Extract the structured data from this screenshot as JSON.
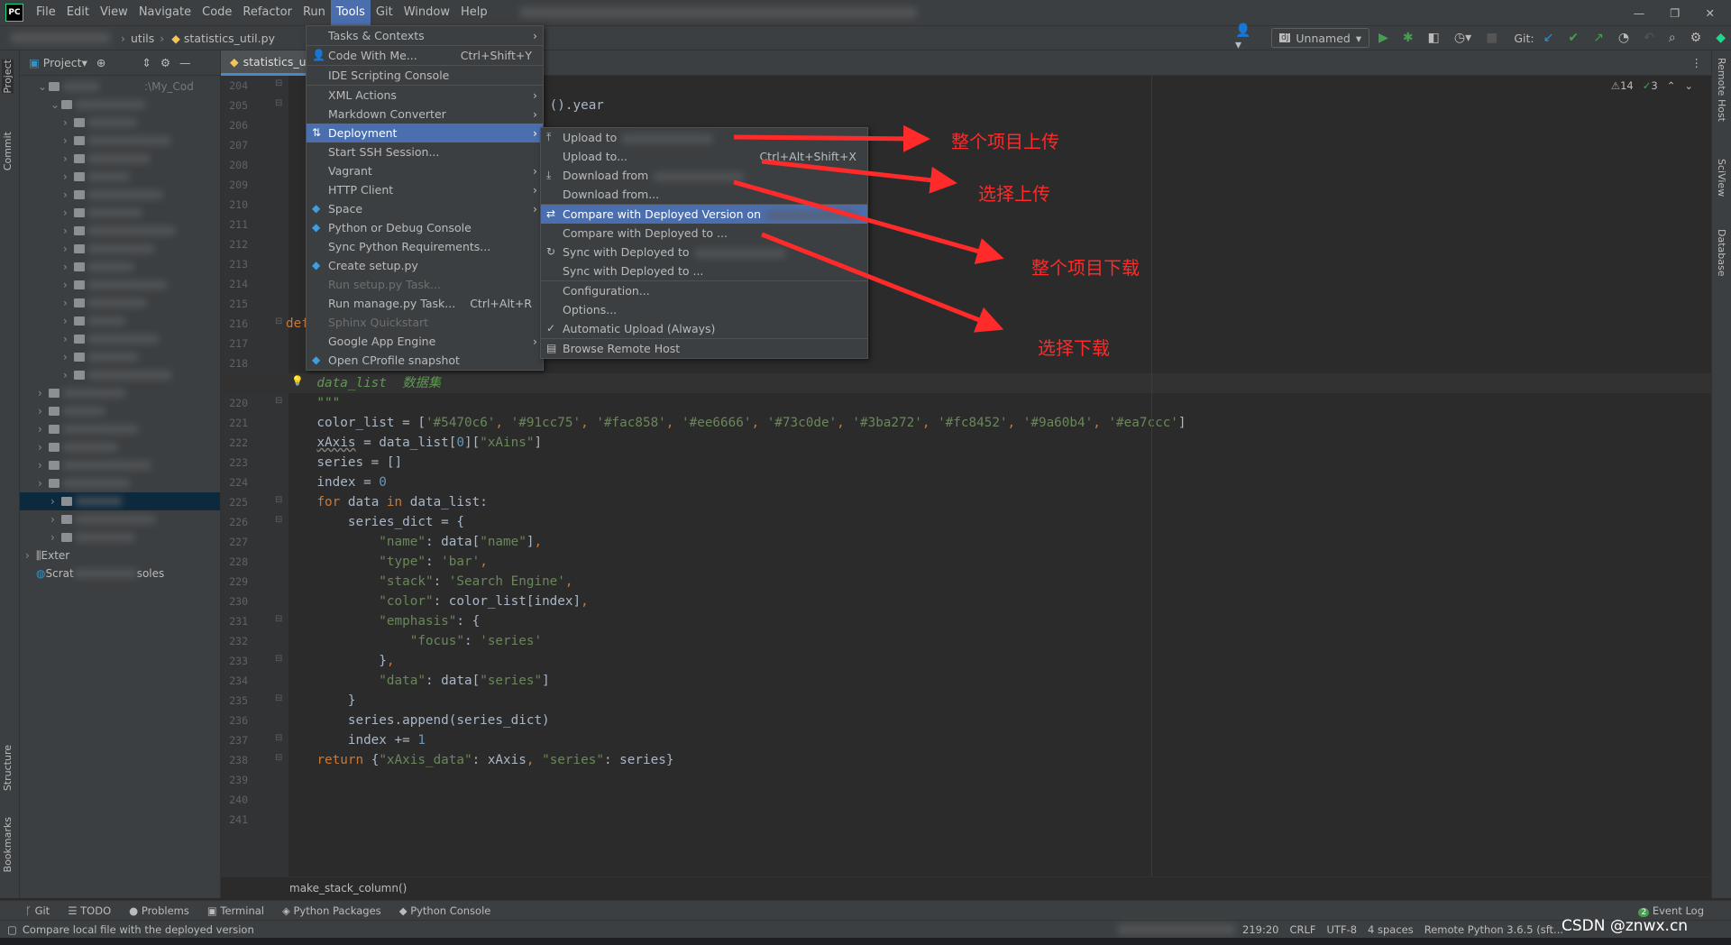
{
  "app": {
    "logo": "PC",
    "menu": [
      "File",
      "Edit",
      "View",
      "Navigate",
      "Code",
      "Refactor",
      "Run",
      "Tools",
      "Git",
      "Window",
      "Help"
    ],
    "active_menu": "Tools"
  },
  "navbar": {
    "crumb_folder": "utils",
    "crumb_file": "statistics_util.py",
    "run_config": "Unnamed",
    "git_label": "Git:"
  },
  "project": {
    "header": "Project",
    "path_fragment": ":\\My_Cod",
    "external": "Exter",
    "scratches_start": "Scrat",
    "scratches_end": "soles"
  },
  "left_stripe": [
    "Project",
    "Commit",
    "Structure",
    "Bookmarks"
  ],
  "right_stripe": [
    "Remote Host",
    "SciView",
    "Database"
  ],
  "editor": {
    "tab": "statistics_util.py",
    "warnings": "14",
    "weak_warnings": "3",
    "breadcrumb": "make_stack_column()",
    "current_line": 219,
    "first_line": 204,
    "last_line": 241,
    "lines": {
      "205": [
        [
          "                                  ().year",
          ""
        ]
      ],
      "216": [
        [
          "def",
          "kw"
        ]
      ],
      "219": [
        [
          "    data_list  数据集",
          "com"
        ]
      ],
      "220": [
        [
          "    \"\"\"",
          "com"
        ]
      ],
      "221": [
        [
          "    color_list = [",
          ""
        ],
        [
          "'#5470c6'",
          "str"
        ],
        [
          ", ",
          "kw"
        ],
        [
          "'#91cc75'",
          "str"
        ],
        [
          ", ",
          "kw"
        ],
        [
          "'#fac858'",
          "str"
        ],
        [
          ", ",
          "kw"
        ],
        [
          "'#ee6666'",
          "str"
        ],
        [
          ", ",
          "kw"
        ],
        [
          "'#73c0de'",
          "str"
        ],
        [
          ", ",
          "kw"
        ],
        [
          "'#3ba272'",
          "str"
        ],
        [
          ", ",
          "kw"
        ],
        [
          "'#fc8452'",
          "str"
        ],
        [
          ", ",
          "kw"
        ],
        [
          "'#9a60b4'",
          "str"
        ],
        [
          ", ",
          "kw"
        ],
        [
          "'#ea7ccc'",
          "str"
        ],
        [
          "]",
          ""
        ]
      ],
      "222": [
        [
          "    ",
          ""
        ],
        [
          "xAxis",
          "sq"
        ],
        [
          " = data_list[",
          ""
        ],
        [
          "0",
          "num"
        ],
        [
          "][",
          ""
        ],
        [
          "\"xAins\"",
          "str"
        ],
        [
          "]",
          ""
        ]
      ],
      "223": [
        [
          "    series = []",
          ""
        ]
      ],
      "224": [
        [
          "    index = ",
          ""
        ],
        [
          "0",
          "num"
        ]
      ],
      "225": [
        [
          "    ",
          ""
        ],
        [
          "for",
          "kw"
        ],
        [
          " data ",
          ""
        ],
        [
          "in",
          "kw"
        ],
        [
          " data_list:",
          ""
        ]
      ],
      "226": [
        [
          "        series_dict = {",
          ""
        ]
      ],
      "227": [
        [
          "            ",
          ""
        ],
        [
          "\"name\"",
          "str"
        ],
        [
          ": data[",
          ""
        ],
        [
          "\"name\"",
          "str"
        ],
        [
          "]",
          ""
        ],
        [
          ",",
          "kw"
        ]
      ],
      "228": [
        [
          "            ",
          ""
        ],
        [
          "\"type\"",
          "str"
        ],
        [
          ": ",
          ""
        ],
        [
          "'bar'",
          "str"
        ],
        [
          ",",
          "kw"
        ]
      ],
      "229": [
        [
          "            ",
          ""
        ],
        [
          "\"stack\"",
          "str"
        ],
        [
          ": ",
          ""
        ],
        [
          "'Search Engine'",
          "str"
        ],
        [
          ",",
          "kw"
        ]
      ],
      "230": [
        [
          "            ",
          ""
        ],
        [
          "\"color\"",
          "str"
        ],
        [
          ": color_list[index]",
          ""
        ],
        [
          ",",
          "kw"
        ]
      ],
      "231": [
        [
          "            ",
          ""
        ],
        [
          "\"emphasis\"",
          "str"
        ],
        [
          ": {",
          ""
        ]
      ],
      "232": [
        [
          "                ",
          ""
        ],
        [
          "\"focus\"",
          "str"
        ],
        [
          ": ",
          ""
        ],
        [
          "'series'",
          "str"
        ]
      ],
      "233": [
        [
          "            }",
          ""
        ],
        [
          ",",
          "kw"
        ]
      ],
      "234": [
        [
          "            ",
          ""
        ],
        [
          "\"data\"",
          "str"
        ],
        [
          ": data[",
          ""
        ],
        [
          "\"series\"",
          "str"
        ],
        [
          "]",
          ""
        ]
      ],
      "235": [
        [
          "        }",
          ""
        ]
      ],
      "236": [
        [
          "        series.append(series_dict)",
          ""
        ]
      ],
      "237": [
        [
          "        index += ",
          ""
        ],
        [
          "1",
          "num"
        ]
      ],
      "238": [
        [
          "    ",
          ""
        ],
        [
          "return",
          "kw"
        ],
        [
          " {",
          ""
        ],
        [
          "\"xAxis_data\"",
          "str"
        ],
        [
          ": xAxis",
          ""
        ],
        [
          ", ",
          "kw"
        ],
        [
          "\"series\"",
          "str"
        ],
        [
          ": series}",
          ""
        ]
      ]
    }
  },
  "tools_menu": [
    {
      "label": "Tasks & Contexts",
      "submenu": true
    },
    {
      "sep": true
    },
    {
      "label": "Code With Me...",
      "shortcut": "Ctrl+Shift+Y",
      "icon": "user-icon"
    },
    {
      "sep": true
    },
    {
      "label": "IDE Scripting Console"
    },
    {
      "sep": true
    },
    {
      "label": "XML Actions",
      "submenu": true
    },
    {
      "label": "Markdown Converter",
      "submenu": true
    },
    {
      "label": "Deployment",
      "submenu": true,
      "selected": true,
      "icon": "deploy-icon"
    },
    {
      "label": "Start SSH Session..."
    },
    {
      "label": "Vagrant",
      "submenu": true
    },
    {
      "label": "HTTP Client",
      "submenu": true
    },
    {
      "label": "Space",
      "submenu": true,
      "icon": "space-icon"
    },
    {
      "label": "Python or Debug Console",
      "icon": "python-icon"
    },
    {
      "label": "Sync Python Requirements..."
    },
    {
      "label": "Create setup.py",
      "icon": "python-file-icon"
    },
    {
      "label": "Run setup.py Task...",
      "disabled": true
    },
    {
      "label": "Run manage.py Task...",
      "shortcut": "Ctrl+Alt+R"
    },
    {
      "label": "Sphinx Quickstart",
      "disabled": true
    },
    {
      "label": "Google App Engine",
      "submenu": true
    },
    {
      "label": "Open CProfile snapshot",
      "icon": "python-file-icon"
    }
  ],
  "deployment_menu": [
    {
      "label": "Upload to",
      "icon": "upload-icon",
      "blurred": true
    },
    {
      "label": "Upload to...",
      "shortcut": "Ctrl+Alt+Shift+X"
    },
    {
      "label": "Download from",
      "icon": "download-icon",
      "blurred": true
    },
    {
      "label": "Download from..."
    },
    {
      "sep": true
    },
    {
      "label": "Compare with Deployed Version on",
      "icon": "compare-icon",
      "selected": true,
      "blurred": true
    },
    {
      "label": "Compare with Deployed to ..."
    },
    {
      "label": "Sync with Deployed to",
      "icon": "sync-icon",
      "blurred": true
    },
    {
      "label": "Sync with Deployed to ..."
    },
    {
      "sep": true
    },
    {
      "label": "Configuration..."
    },
    {
      "label": "Options..."
    },
    {
      "label": "Automatic Upload (Always)",
      "icon": "check-icon"
    },
    {
      "sep": true
    },
    {
      "label": "Browse Remote Host",
      "icon": "server-icon"
    }
  ],
  "annotations": [
    "整个项目上传",
    "选择上传",
    "整个项目下载",
    "选择下载"
  ],
  "annotation_color": "#ff2a2a",
  "tool_windows": [
    "Git",
    "TODO",
    "Problems",
    "Terminal",
    "Python Packages",
    "Python Console"
  ],
  "event_log": {
    "label": "Event Log",
    "count": "2"
  },
  "status": {
    "message": "Compare local file with the deployed version",
    "position": "219:20",
    "line_sep": "CRLF",
    "encoding": "UTF-8",
    "indent": "4 spaces",
    "interpreter": "Remote Python 3.6.5 (sft...",
    "watermark": "CSDN @znwx.cn"
  },
  "colors": {
    "accent": "#4b6eaf",
    "background": "#2b2b2b",
    "panel": "#3c3f41"
  }
}
